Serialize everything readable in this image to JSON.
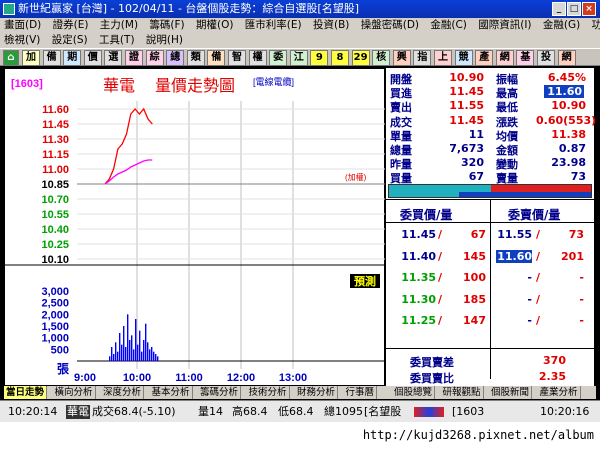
{
  "window": {
    "title": "新世紀贏家 [台灣] - 102/04/11 - 台盤個股走勢：綜合自選股[名望股]",
    "controls": {
      "minimize": "_",
      "maximize": "□",
      "close": "×"
    }
  },
  "menu1": {
    "items": [
      "畫面(D)",
      "證券(E)",
      "主力(M)",
      "籌碼(F)",
      "期權(O)",
      "匯市利率(E)",
      "投資(B)",
      "操盤密碼(D)",
      "金融(C)",
      "國際資訊(I)",
      "金融(G)",
      "功能選擇(F)"
    ],
    "right_label": "功能選擇(F)"
  },
  "menu2": {
    "items": [
      "檢視(V)",
      "設定(S)",
      "工具(T)",
      "說明(H)"
    ]
  },
  "toolbar": {
    "buttons": [
      "加",
      "備",
      "期",
      "價",
      "選",
      "證",
      "綜",
      "總",
      "類",
      "備",
      "智",
      "權",
      "委",
      "江",
      "9",
      "8",
      "29",
      "核",
      "興",
      "指",
      "上",
      "競",
      "產",
      "網",
      "基",
      "投",
      "網"
    ]
  },
  "chart": {
    "code": "[1603]",
    "stock_name": "華電",
    "title": "量價走勢圖",
    "subtitle": "[電線電纜]",
    "price_label_right": "(加權)",
    "predict_button": "預測",
    "volume_unit_label": "張",
    "price_ticks": [
      "11.60",
      "11.45",
      "11.30",
      "11.15",
      "11.00",
      "10.85",
      "10.70",
      "10.55",
      "10.40",
      "10.25",
      "10.10"
    ],
    "volume_ticks": [
      "3,000",
      "2,500",
      "2,000",
      "1,500",
      "1,000",
      "500"
    ],
    "time_ticks": [
      "9:00",
      "10:00",
      "11:00",
      "12:00",
      "13:00"
    ]
  },
  "chart_data": {
    "type": "line",
    "title": "量價走勢圖",
    "xlabel": "",
    "ylabel": "",
    "ylim": [
      10.1,
      11.6
    ],
    "reference_price": 10.85,
    "x": [
      "9:00",
      "9:10",
      "9:20",
      "9:30",
      "9:40",
      "9:45",
      "9:50",
      "9:55",
      "10:00",
      "10:05",
      "10:10",
      "10:15"
    ],
    "series": [
      {
        "values": [
          10.85,
          10.9,
          11.0,
          11.2,
          11.25,
          11.35,
          11.55,
          11.6,
          11.55,
          11.6,
          11.5,
          11.45
        ],
        "color": "#ff0000"
      },
      {
        "values": [
          10.85,
          10.88,
          10.92,
          10.95,
          10.97,
          10.99,
          11.02,
          11.04,
          11.06,
          11.08,
          11.09,
          11.09
        ],
        "color": "#ff00ff"
      }
    ],
    "volume": {
      "ylim": [
        0,
        3000
      ],
      "values": [
        200,
        600,
        300,
        800,
        400,
        1200,
        700,
        1500,
        600,
        2000,
        900,
        1100,
        500,
        1800,
        700,
        1300,
        400,
        900,
        1600,
        800,
        500,
        600,
        400,
        300,
        200
      ],
      "color": "#0000ff"
    }
  },
  "quote": {
    "rows": [
      {
        "l1": "開盤",
        "v1": "10.90",
        "l2": "振幅",
        "v2": "6.45%",
        "c1": "red",
        "c2": "red"
      },
      {
        "l1": "買進",
        "v1": "11.45",
        "l2": "最高",
        "v2": "11.60",
        "c1": "red",
        "c2": "hl"
      },
      {
        "l1": "賣出",
        "v1": "11.55",
        "l2": "最低",
        "v2": "10.90",
        "c1": "red",
        "c2": "red"
      },
      {
        "l1": "成交",
        "v1": "11.45",
        "l2": "漲跌",
        "v2": "0.60(553)",
        "c1": "red",
        "c2": "red"
      },
      {
        "l1": "單量",
        "v1": "11",
        "l2": "均價",
        "v2": "11.38",
        "c1": "blue",
        "c2": "red"
      },
      {
        "l1": "總量",
        "v1": "7,673",
        "l2": "金額",
        "v2": "0.87",
        "c1": "blue",
        "c2": "blue"
      },
      {
        "l1": "昨量",
        "v1": "320",
        "l2": "變動",
        "v2": "23.98",
        "c1": "blue",
        "c2": "blue"
      },
      {
        "l1": "買量",
        "v1": "67",
        "l2": "賣量",
        "v2": "73",
        "c1": "blue",
        "c2": "blue"
      }
    ],
    "bid_header": "委買價/量",
    "ask_header": "委賣價/量",
    "bids": [
      {
        "price": "11.45",
        "qty": "67"
      },
      {
        "price": "11.40",
        "qty": "145"
      },
      {
        "price": "11.35",
        "qty": "100"
      },
      {
        "price": "11.30",
        "qty": "185"
      },
      {
        "price": "11.25",
        "qty": "147"
      }
    ],
    "asks": [
      {
        "price": "11.55",
        "qty": "73"
      },
      {
        "price": "11.60",
        "qty": "201"
      },
      {
        "price": "-",
        "qty": "-"
      },
      {
        "price": "-",
        "qty": "-"
      },
      {
        "price": "-",
        "qty": "-"
      }
    ],
    "diff_label": "委買賣差",
    "diff_value": "370",
    "ratio_label": "委買賣比",
    "ratio_value": "2.35"
  },
  "tabs": [
    "當日走勢",
    "橫向分析",
    "深度分析",
    "基本分析",
    "籌碼分析",
    "技術分析",
    "財務分析",
    "行事曆",
    "個股總覽",
    "研報觀點",
    "個股新聞",
    "產業分析"
  ],
  "status": {
    "time": "10:20:14",
    "name": "華電",
    "deal": "成交68.4(-5.10)",
    "vol": "量14",
    "high": "高68.4",
    "low": "低68.4",
    "total": "總1095",
    "group": "[名望股",
    "code": "[1603",
    "clock": "10:20:16"
  },
  "watermark": "http://kujd3268.pixnet.net/album",
  "colors": {
    "price_line": "#ff0000",
    "avg_line": "#ff00ff",
    "volume_bar": "#0000ff",
    "panel_text": "#00008b"
  }
}
